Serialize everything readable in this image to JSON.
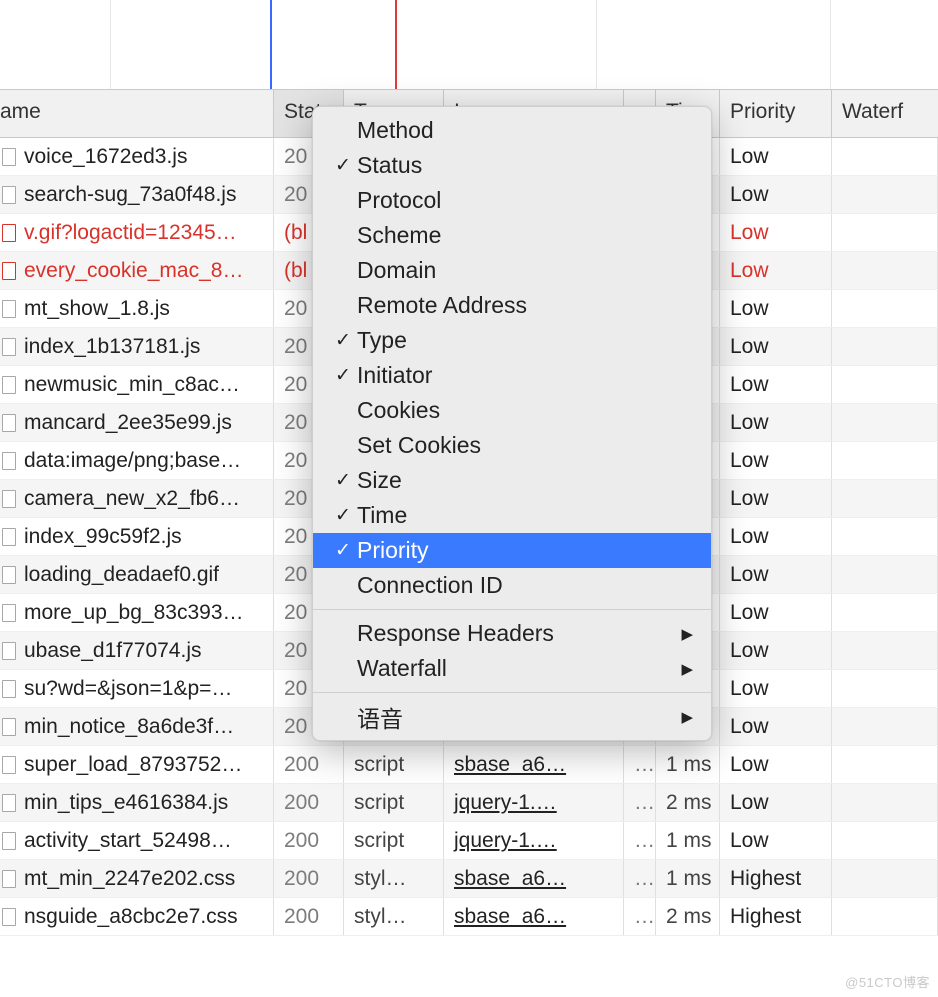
{
  "headers": {
    "name": "ame",
    "status": "Stat",
    "type": "T",
    "initiator": "I",
    "other": "",
    "time": "Ti",
    "priority": "Priority",
    "waterfall": "Waterf"
  },
  "rows": [
    {
      "name": "voice_1672ed3.js",
      "status": "20",
      "type": "",
      "initiator": "",
      "other": "",
      "time": "",
      "priority": "Low",
      "blocked": false
    },
    {
      "name": "search-sug_73a0f48.js",
      "status": "20",
      "type": "",
      "initiator": "",
      "other": "",
      "time": "",
      "priority": "Low",
      "blocked": false
    },
    {
      "name": "v.gif?logactid=12345…",
      "status": "(bl",
      "type": "",
      "initiator": "",
      "other": "",
      "time": "",
      "priority": "Low",
      "blocked": true
    },
    {
      "name": "every_cookie_mac_8…",
      "status": "(bl",
      "type": "",
      "initiator": "",
      "other": "",
      "time": "",
      "priority": "Low",
      "blocked": true
    },
    {
      "name": "mt_show_1.8.js",
      "status": "20",
      "type": "",
      "initiator": "",
      "other": "",
      "time": "",
      "priority": "Low",
      "blocked": false
    },
    {
      "name": "index_1b137181.js",
      "status": "20",
      "type": "",
      "initiator": "",
      "other": "",
      "time": "",
      "priority": "Low",
      "blocked": false
    },
    {
      "name": "newmusic_min_c8ac…",
      "status": "20",
      "type": "",
      "initiator": "",
      "other": "",
      "time": "",
      "priority": "Low",
      "blocked": false
    },
    {
      "name": "mancard_2ee35e99.js",
      "status": "20",
      "type": "",
      "initiator": "",
      "other": "",
      "time": "",
      "priority": "Low",
      "blocked": false
    },
    {
      "name": "data:image/png;base…",
      "status": "20",
      "type": "",
      "initiator": "",
      "other": "",
      "time": "",
      "priority": "Low",
      "blocked": false
    },
    {
      "name": "camera_new_x2_fb6…",
      "status": "20",
      "type": "",
      "initiator": "",
      "other": "",
      "time": "",
      "priority": "Low",
      "blocked": false
    },
    {
      "name": "index_99c59f2.js",
      "status": "20",
      "type": "",
      "initiator": "",
      "other": "",
      "time": "",
      "priority": "Low",
      "blocked": false
    },
    {
      "name": "loading_deadaef0.gif",
      "status": "20",
      "type": "",
      "initiator": "",
      "other": "",
      "time": "",
      "priority": "Low",
      "blocked": false
    },
    {
      "name": "more_up_bg_83c393…",
      "status": "20",
      "type": "",
      "initiator": "",
      "other": "",
      "time": "",
      "priority": "Low",
      "blocked": false
    },
    {
      "name": "ubase_d1f77074.js",
      "status": "20",
      "type": "",
      "initiator": "",
      "other": "",
      "time": "",
      "priority": "Low",
      "blocked": false
    },
    {
      "name": "su?wd=&json=1&p=…",
      "status": "20",
      "type": "",
      "initiator": "",
      "other": "",
      "time": "",
      "priority": "Low",
      "blocked": false
    },
    {
      "name": "min_notice_8a6de3f…",
      "status": "20",
      "type": "",
      "initiator": "",
      "other": "",
      "time": "",
      "priority": "Low",
      "blocked": false
    },
    {
      "name": "super_load_8793752…",
      "status": "200",
      "type": "script",
      "initiator": "sbase_a6…",
      "other": "…",
      "time": "1 ms",
      "priority": "Low",
      "blocked": false
    },
    {
      "name": "min_tips_e4616384.js",
      "status": "200",
      "type": "script",
      "initiator": "jquery-1.…",
      "other": "…",
      "time": "2 ms",
      "priority": "Low",
      "blocked": false
    },
    {
      "name": "activity_start_52498…",
      "status": "200",
      "type": "script",
      "initiator": "jquery-1.…",
      "other": "…",
      "time": "1 ms",
      "priority": "Low",
      "blocked": false
    },
    {
      "name": "mt_min_2247e202.css",
      "status": "200",
      "type": "styl…",
      "initiator": "sbase_a6…",
      "other": "…",
      "time": "1 ms",
      "priority": "Highest",
      "blocked": false
    },
    {
      "name": "nsguide_a8cbc2e7.css",
      "status": "200",
      "type": "styl…",
      "initiator": "sbase_a6…",
      "other": "…",
      "time": "2 ms",
      "priority": "Highest",
      "blocked": false
    }
  ],
  "context_menu": {
    "items": [
      {
        "label": "Method",
        "checked": false,
        "submenu": false,
        "highlight": false
      },
      {
        "label": "Status",
        "checked": true,
        "submenu": false,
        "highlight": false
      },
      {
        "label": "Protocol",
        "checked": false,
        "submenu": false,
        "highlight": false
      },
      {
        "label": "Scheme",
        "checked": false,
        "submenu": false,
        "highlight": false
      },
      {
        "label": "Domain",
        "checked": false,
        "submenu": false,
        "highlight": false
      },
      {
        "label": "Remote Address",
        "checked": false,
        "submenu": false,
        "highlight": false
      },
      {
        "label": "Type",
        "checked": true,
        "submenu": false,
        "highlight": false
      },
      {
        "label": "Initiator",
        "checked": true,
        "submenu": false,
        "highlight": false
      },
      {
        "label": "Cookies",
        "checked": false,
        "submenu": false,
        "highlight": false
      },
      {
        "label": "Set Cookies",
        "checked": false,
        "submenu": false,
        "highlight": false
      },
      {
        "label": "Size",
        "checked": true,
        "submenu": false,
        "highlight": false
      },
      {
        "label": "Time",
        "checked": true,
        "submenu": false,
        "highlight": false
      },
      {
        "label": "Priority",
        "checked": true,
        "submenu": false,
        "highlight": true
      },
      {
        "label": "Connection ID",
        "checked": false,
        "submenu": false,
        "highlight": false
      },
      {
        "separator": true
      },
      {
        "label": "Response Headers",
        "checked": false,
        "submenu": true,
        "highlight": false
      },
      {
        "label": "Waterfall",
        "checked": false,
        "submenu": true,
        "highlight": false
      },
      {
        "separator": true
      },
      {
        "label": "语音",
        "checked": false,
        "submenu": true,
        "highlight": false
      }
    ]
  },
  "watermark": "@51CTO博客"
}
